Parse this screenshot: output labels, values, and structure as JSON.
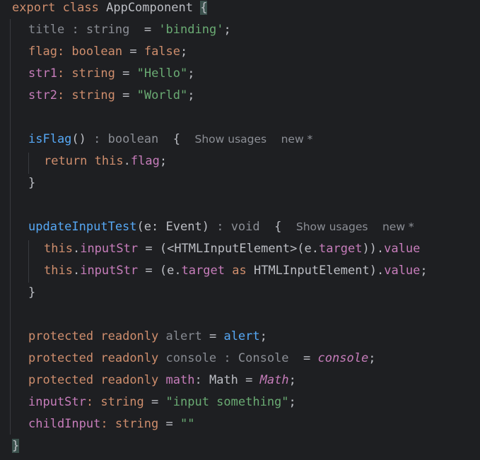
{
  "code": {
    "line1": {
      "kw_export": "export",
      "kw_class": "class",
      "class_name": "AppComponent",
      "brace": "{"
    },
    "line2": {
      "field": "title",
      "type_hint": ": string",
      "eq": "=",
      "value": "'binding'",
      "semi": ";"
    },
    "line3": {
      "field": "flag",
      "colon_type": ": boolean",
      "eq": "=",
      "value": "false",
      "semi": ";"
    },
    "line4": {
      "field": "str1",
      "colon_type": ": string",
      "eq": "=",
      "value": "\"Hello\"",
      "semi": ";"
    },
    "line5": {
      "field": "str2",
      "colon_type": ": string",
      "eq": "=",
      "value": "\"World\"",
      "semi": ";"
    },
    "line7": {
      "method": "isFlag",
      "parens": "()",
      "type_hint": ": boolean",
      "brace": "{",
      "usages": "Show usages",
      "new_label": "new *"
    },
    "line8": {
      "kw_return": "return",
      "kw_this": "this",
      "dot": ".",
      "field": "flag",
      "semi": ";"
    },
    "line9": {
      "brace": "}"
    },
    "line11": {
      "method": "updateInputTest",
      "open": "(",
      "param": "e",
      "colon": ":",
      "param_type": "Event",
      "close": ")",
      "type_hint": ": void",
      "brace": "{",
      "usages": "Show usages",
      "new_label": "new *"
    },
    "line12": {
      "kw_this": "this",
      "dot": ".",
      "field": "inputStr",
      "eq": "=",
      "cast_open": "(<HTMLInputElement>(e.",
      "target": "target",
      "cast_close": ")).",
      "value": "value"
    },
    "line13": {
      "kw_this": "this",
      "dot": ".",
      "field": "inputStr",
      "eq": "=",
      "open": "(e.",
      "target": "target",
      "kw_as": "as",
      "type": "HTMLInputElement",
      "close": ").",
      "value": "value",
      "semi": ";"
    },
    "line14": {
      "brace": "}"
    },
    "line16": {
      "kw_protected": "protected",
      "kw_readonly": "readonly",
      "field": "alert",
      "eq": "=",
      "value": "alert",
      "semi": ";"
    },
    "line17": {
      "kw_protected": "protected",
      "kw_readonly": "readonly",
      "field": "console",
      "type_hint": ": Console",
      "eq": "=",
      "value": "console",
      "semi": ";"
    },
    "line18": {
      "kw_protected": "protected",
      "kw_readonly": "readonly",
      "field": "math",
      "colon": ":",
      "type": "Math",
      "eq": "=",
      "value": "Math",
      "semi": ";"
    },
    "line19": {
      "field": "inputStr",
      "colon_type": ": string",
      "eq": "=",
      "value": "\"input something\"",
      "semi": ";"
    },
    "line20": {
      "field": "childInput",
      "colon_type": ": string",
      "eq": "=",
      "value": "\"\""
    },
    "line21": {
      "brace": "}"
    }
  },
  "colors": {
    "background": "#1e1f22",
    "keyword": "#cf8e6d",
    "field": "#c77dbb",
    "string": "#6aab73",
    "function": "#56a8f5",
    "text": "#bcbec4",
    "hint": "#7a7e85",
    "brace_highlight": "#3b514d"
  }
}
